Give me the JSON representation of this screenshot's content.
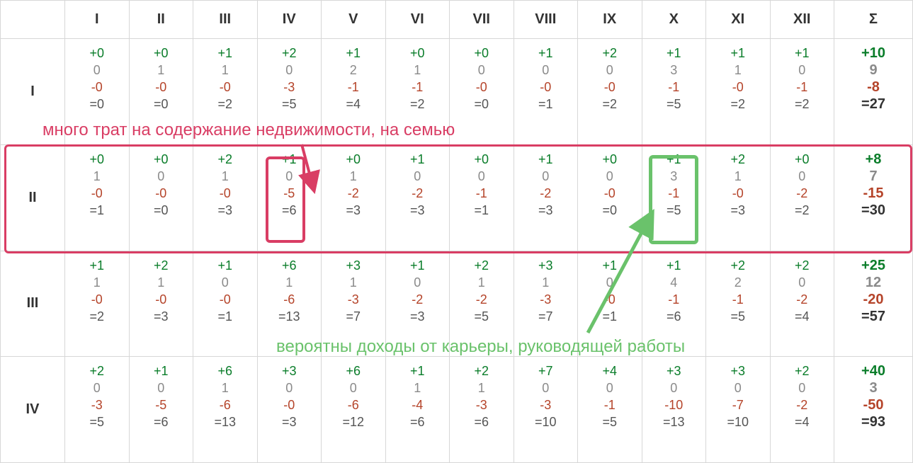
{
  "chart_data": {
    "type": "table",
    "title": "",
    "columns": [
      "I",
      "II",
      "III",
      "IV",
      "V",
      "VI",
      "VII",
      "VIII",
      "IX",
      "X",
      "XI",
      "XII",
      "Σ"
    ],
    "row_labels": [
      "I",
      "II",
      "III",
      "IV"
    ],
    "value_rows_per_cell": [
      "plus",
      "mid",
      "minus",
      "eq"
    ],
    "annotations": [
      {
        "text": "много трат на содержание недвижимости, на семью",
        "target": "row II, col IV",
        "color": "#d93d64"
      },
      {
        "text": "вероятны доходы от карьеры, руководящей работы",
        "target": "row II, col X",
        "color": "#6ac26b"
      }
    ]
  },
  "headers": [
    "I",
    "II",
    "III",
    "IV",
    "V",
    "VI",
    "VII",
    "VIII",
    "IX",
    "X",
    "XI",
    "XII",
    "Σ"
  ],
  "rows": [
    {
      "label": "I",
      "cells": [
        {
          "p": "+0",
          "m": "0",
          "n": "-0",
          "e": "=0"
        },
        {
          "p": "+0",
          "m": "1",
          "n": "-0",
          "e": "=0"
        },
        {
          "p": "+1",
          "m": "1",
          "n": "-0",
          "e": "=2"
        },
        {
          "p": "+2",
          "m": "0",
          "n": "-3",
          "e": "=5"
        },
        {
          "p": "+1",
          "m": "2",
          "n": "-1",
          "e": "=4"
        },
        {
          "p": "+0",
          "m": "1",
          "n": "-1",
          "e": "=2"
        },
        {
          "p": "+0",
          "m": "0",
          "n": "-0",
          "e": "=0"
        },
        {
          "p": "+1",
          "m": "0",
          "n": "-0",
          "e": "=1"
        },
        {
          "p": "+2",
          "m": "0",
          "n": "-0",
          "e": "=2"
        },
        {
          "p": "+1",
          "m": "3",
          "n": "-1",
          "e": "=5"
        },
        {
          "p": "+1",
          "m": "1",
          "n": "-0",
          "e": "=2"
        },
        {
          "p": "+1",
          "m": "0",
          "n": "-1",
          "e": "=2"
        }
      ],
      "sum": {
        "p": "+10",
        "m": "9",
        "n": "-8",
        "e": "=27"
      }
    },
    {
      "label": "II",
      "cells": [
        {
          "p": "+0",
          "m": "1",
          "n": "-0",
          "e": "=1"
        },
        {
          "p": "+0",
          "m": "0",
          "n": "-0",
          "e": "=0"
        },
        {
          "p": "+2",
          "m": "1",
          "n": "-0",
          "e": "=3"
        },
        {
          "p": "+1",
          "m": "0",
          "n": "-5",
          "e": "=6"
        },
        {
          "p": "+0",
          "m": "1",
          "n": "-2",
          "e": "=3"
        },
        {
          "p": "+1",
          "m": "0",
          "n": "-2",
          "e": "=3"
        },
        {
          "p": "+0",
          "m": "0",
          "n": "-1",
          "e": "=1"
        },
        {
          "p": "+1",
          "m": "0",
          "n": "-2",
          "e": "=3"
        },
        {
          "p": "+0",
          "m": "0",
          "n": "-0",
          "e": "=0"
        },
        {
          "p": "+1",
          "m": "3",
          "n": "-1",
          "e": "=5"
        },
        {
          "p": "+2",
          "m": "1",
          "n": "-0",
          "e": "=3"
        },
        {
          "p": "+0",
          "m": "0",
          "n": "-2",
          "e": "=2"
        }
      ],
      "sum": {
        "p": "+8",
        "m": "7",
        "n": "-15",
        "e": "=30"
      }
    },
    {
      "label": "III",
      "cells": [
        {
          "p": "+1",
          "m": "1",
          "n": "-0",
          "e": "=2"
        },
        {
          "p": "+2",
          "m": "1",
          "n": "-0",
          "e": "=3"
        },
        {
          "p": "+1",
          "m": "0",
          "n": "-0",
          "e": "=1"
        },
        {
          "p": "+6",
          "m": "1",
          "n": "-6",
          "e": "=13"
        },
        {
          "p": "+3",
          "m": "1",
          "n": "-3",
          "e": "=7"
        },
        {
          "p": "+1",
          "m": "0",
          "n": "-2",
          "e": "=3"
        },
        {
          "p": "+2",
          "m": "1",
          "n": "-2",
          "e": "=5"
        },
        {
          "p": "+3",
          "m": "1",
          "n": "-3",
          "e": "=7"
        },
        {
          "p": "+1",
          "m": "0",
          "n": "-0",
          "e": "=1"
        },
        {
          "p": "+1",
          "m": "4",
          "n": "-1",
          "e": "=6"
        },
        {
          "p": "+2",
          "m": "2",
          "n": "-1",
          "e": "=5"
        },
        {
          "p": "+2",
          "m": "0",
          "n": "-2",
          "e": "=4"
        }
      ],
      "sum": {
        "p": "+25",
        "m": "12",
        "n": "-20",
        "e": "=57"
      }
    },
    {
      "label": "IV",
      "cells": [
        {
          "p": "+2",
          "m": "0",
          "n": "-3",
          "e": "=5"
        },
        {
          "p": "+1",
          "m": "0",
          "n": "-5",
          "e": "=6"
        },
        {
          "p": "+6",
          "m": "1",
          "n": "-6",
          "e": "=13"
        },
        {
          "p": "+3",
          "m": "0",
          "n": "-0",
          "e": "=3"
        },
        {
          "p": "+6",
          "m": "0",
          "n": "-6",
          "e": "=12"
        },
        {
          "p": "+1",
          "m": "1",
          "n": "-4",
          "e": "=6"
        },
        {
          "p": "+2",
          "m": "1",
          "n": "-3",
          "e": "=6"
        },
        {
          "p": "+7",
          "m": "0",
          "n": "-3",
          "e": "=10"
        },
        {
          "p": "+4",
          "m": "0",
          "n": "-1",
          "e": "=5"
        },
        {
          "p": "+3",
          "m": "0",
          "n": "-10",
          "e": "=13"
        },
        {
          "p": "+3",
          "m": "0",
          "n": "-7",
          "e": "=10"
        },
        {
          "p": "+2",
          "m": "0",
          "n": "-2",
          "e": "=4"
        }
      ],
      "sum": {
        "p": "+40",
        "m": "3",
        "n": "-50",
        "e": "=93"
      }
    }
  ],
  "annot": {
    "red_label": "много трат на содержание недвижимости, на семью",
    "green_label": "вероятны доходы от карьеры, руководящей работы"
  }
}
